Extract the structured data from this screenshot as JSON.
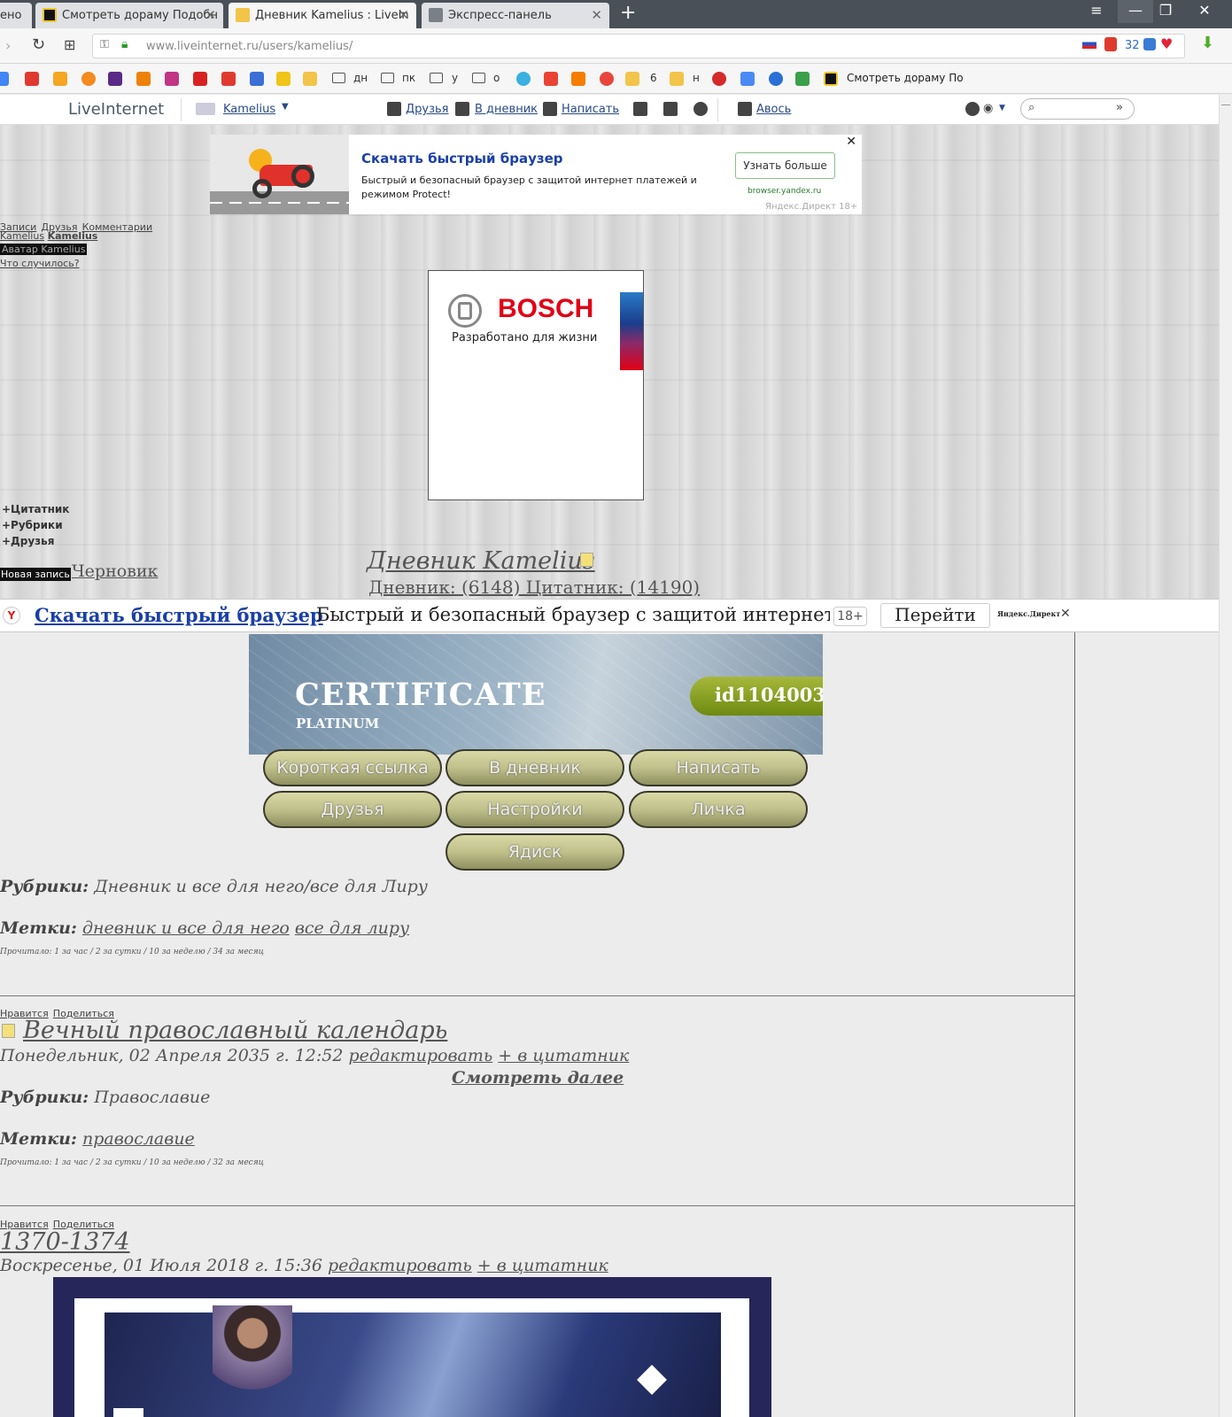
{
  "browser": {
    "tabs": [
      {
        "label": "ено"
      },
      {
        "label": "Смотреть дораму Подобн"
      },
      {
        "label": "Дневник Kamelius : LiveIn"
      },
      {
        "label": "Экспресс-панель"
      }
    ],
    "url": "www.liveinternet.ru/users/kamelius/",
    "badge_count": "32"
  },
  "bookmarks": {
    "folders": [
      "дн",
      "пк",
      "у",
      "о"
    ],
    "counter": "6",
    "letter": "н",
    "last": "Смотреть дораму По"
  },
  "liheader": {
    "logo": "LiveInternet",
    "user": "Kamelius",
    "friends": "Друзья",
    "diary": "В дневник",
    "write": "Написать",
    "avos": "Авось"
  },
  "top_ad": {
    "title": "Скачать быстрый браузер",
    "description": "Быстрый и безопасный браузер с защитой интернет платежей и режимом Protect!",
    "button": "Узнать больше",
    "domain": "browser.yandex.ru",
    "provider": "Яндекс.Директ",
    "age": "18+"
  },
  "left_links": {
    "posts": "Записи",
    "friends": "Друзья",
    "comments": "Комментарии",
    "user_short": "Kamelius",
    "user_bold": "Kamelius",
    "avatar": "Аватар Kamelius",
    "status": "Что случилось?",
    "quotes": "+Цитатник",
    "rubrics": "+Рубрики",
    "friends2": "+Друзья",
    "new_post": "Новая запись",
    "draft": "Черновик"
  },
  "bosch": {
    "brand": "BOSCH",
    "slogan": "Разработано для жизни"
  },
  "diary": {
    "title": "Дневник Kamelius",
    "stats": "Дневник: (6148) Цитатник: (14190)"
  },
  "bottom_ad": {
    "title": "Скачать быстрый браузер",
    "text": "Быстрый и безопасный браузер с защитой интернет п...",
    "age": "18+",
    "button": "Перейти",
    "provider": "Яндекс.Директ"
  },
  "certificate": {
    "title": "CERTIFICATE",
    "level": "PLATINUM",
    "id": "id1104003"
  },
  "buttons": [
    "Короткая ссылка",
    "В дневник",
    "Написать",
    "Друзья",
    "Настройки",
    "Личка",
    "Ядиск"
  ],
  "post1": {
    "rubric_label": "Рубрики:",
    "rubric": "Дневник и все для него/все для Лиру",
    "tags_label": "Метки:",
    "tag1": "дневник и все для него",
    "tag2": "все для лиру",
    "reads": "Прочитало: 1 за час / 2 за сутки / 10 за неделю / 34 за месяц"
  },
  "post2": {
    "like": "Нравится",
    "share": "Поделиться",
    "title": "Вечный православный календарь",
    "date": "Понедельник, 02 Апреля 2035 г. 12:52",
    "edit": "редактировать",
    "quote": "+ в цитатник",
    "more": "Смотреть далее",
    "rubric_label": "Рубрики:",
    "rubric": "Православие",
    "tags_label": "Метки:",
    "tag1": "православие",
    "reads": "Прочитало: 1 за час / 2 за сутки / 10 за неделю / 32 за месяц"
  },
  "post3": {
    "like": "Нравится",
    "share": "Поделиться",
    "title": "1370-1374",
    "date": "Воскресенье, 01 Июля 2018 г. 15:36",
    "edit": "редактировать",
    "quote": "+ в цитатник"
  }
}
